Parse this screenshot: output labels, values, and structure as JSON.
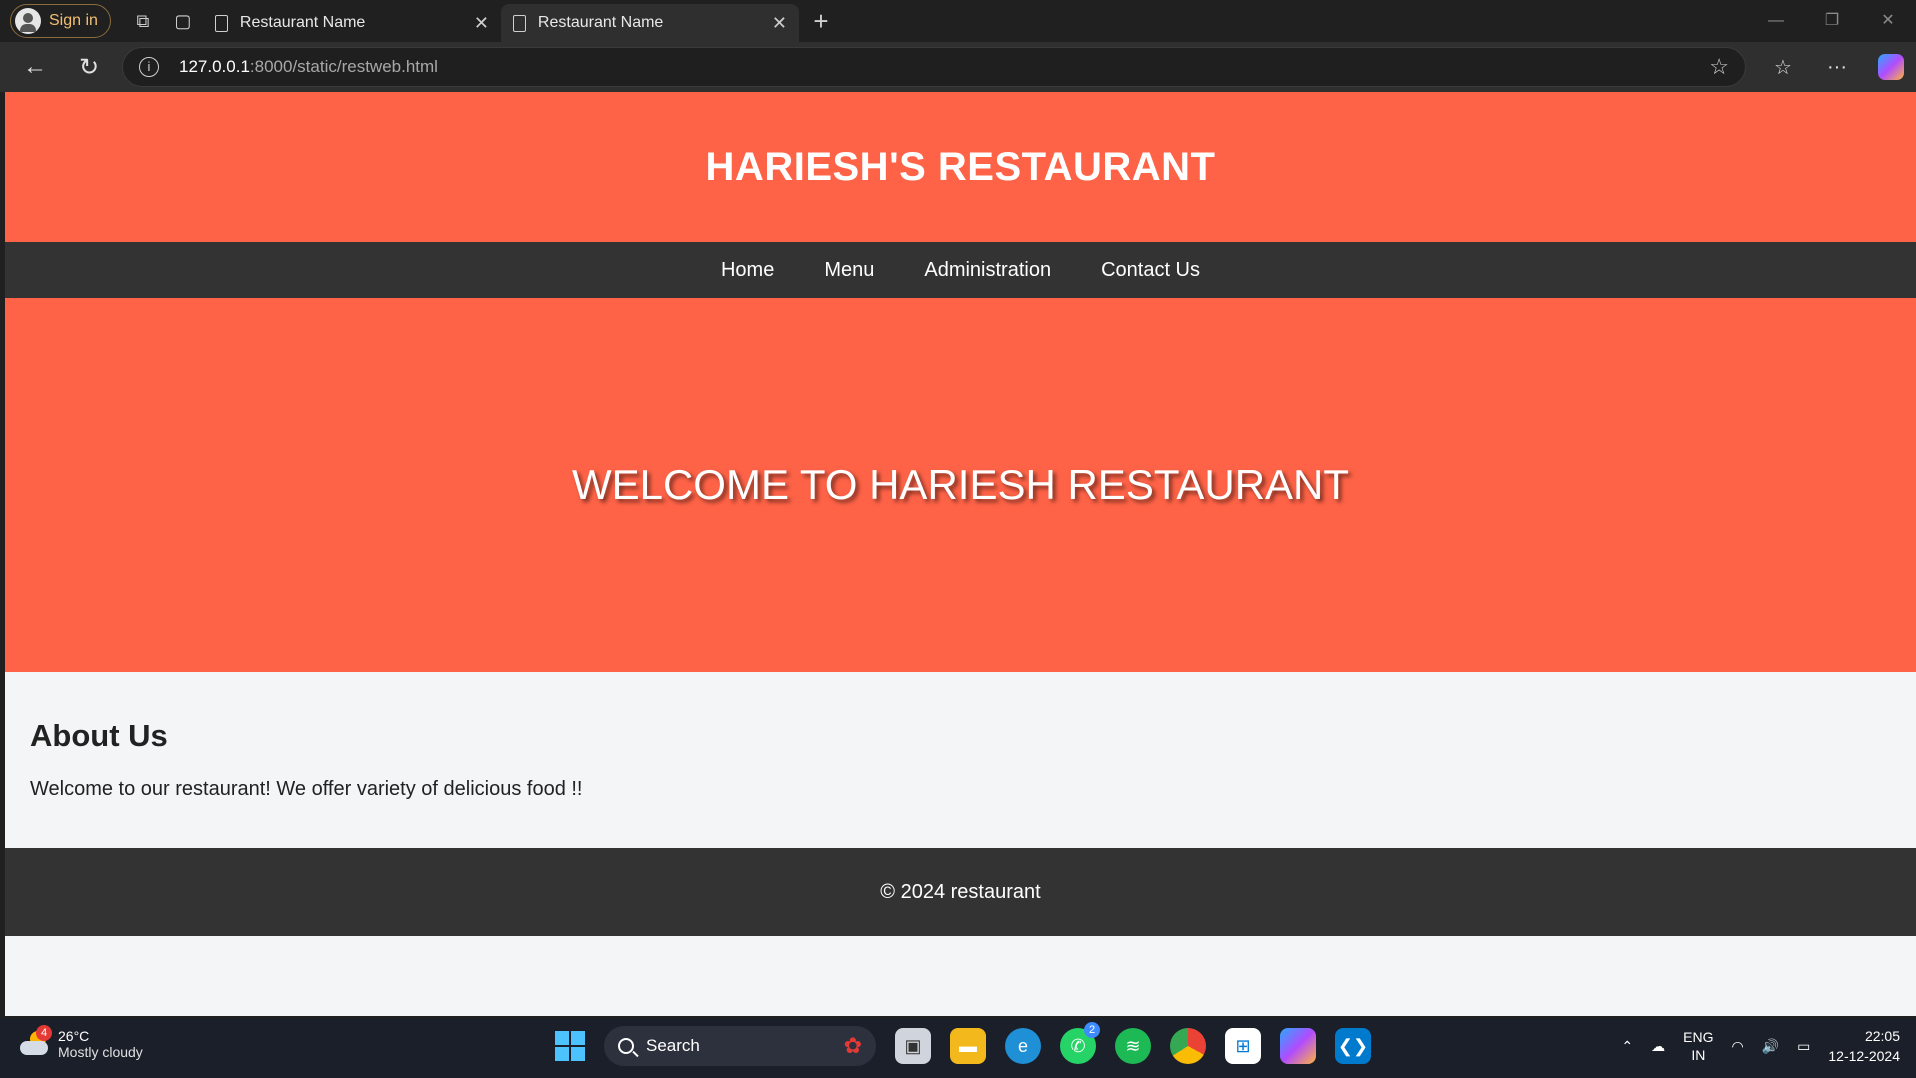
{
  "browser": {
    "signin_label": "Sign in",
    "tabs": [
      {
        "title": "Restaurant Name"
      },
      {
        "title": "Restaurant Name"
      }
    ],
    "url_host": "127.0.0.1",
    "url_path": ":8000/static/restweb.html"
  },
  "site": {
    "header_title": "HARIESH'S RESTAURANT",
    "nav": [
      "Home",
      "Menu",
      "Administration",
      "Contact Us"
    ],
    "hero_text": "WELCOME TO HARIESH RESTAURANT",
    "about_heading": "About Us",
    "about_text": "Welcome to our restaurant! We offer variety of delicious food !!",
    "footer_text": "© 2024 restaurant",
    "colors": {
      "primary": "#ff6347",
      "dark": "#333333"
    }
  },
  "taskbar": {
    "weather_badge": "4",
    "temperature": "26°C",
    "condition": "Mostly cloudy",
    "search_label": "Search",
    "whatsapp_badge": "2",
    "lang_top": "ENG",
    "lang_bottom": "IN",
    "time": "22:05",
    "date": "12-12-2024"
  }
}
